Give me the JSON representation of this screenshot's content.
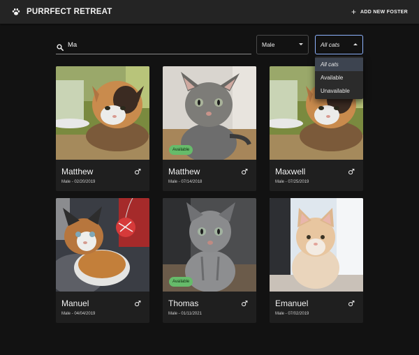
{
  "header": {
    "title": "PURRFECT RETREAT",
    "add_label": "ADD NEW FOSTER",
    "brand_icon": "paw-icon",
    "add_icon": "plus-icon"
  },
  "filters": {
    "search_value": "Ma",
    "gender_value": "Male",
    "status_value": "All cats",
    "status_options": [
      "All cats",
      "Available",
      "Unavailable"
    ]
  },
  "cats": [
    {
      "name": "Matthew",
      "meta": "Male - 02/20/2019",
      "badge": ""
    },
    {
      "name": "Matthew",
      "meta": "Male - 07/14/2018",
      "badge": "Available"
    },
    {
      "name": "Maxwell",
      "meta": "Male - 07/25/2019",
      "badge": ""
    },
    {
      "name": "Manuel",
      "meta": "Male - 04/04/2019",
      "badge": ""
    },
    {
      "name": "Thomas",
      "meta": "Male - 01/11/2021",
      "badge": "Available"
    },
    {
      "name": "Emanuel",
      "meta": "Male - 07/02/2019",
      "badge": ""
    }
  ],
  "colors": {
    "background": "#121212",
    "surface": "#1f1f1f",
    "appbar": "#242424",
    "badge": "#66bb6a",
    "focus": "#8fb4ff"
  }
}
